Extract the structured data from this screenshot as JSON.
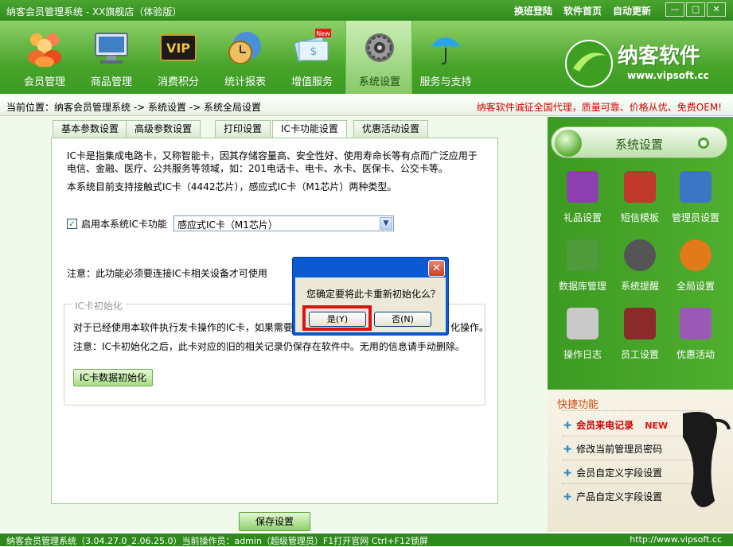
{
  "window": {
    "title": "纳客会员管理系统 - XX旗舰店（体验版）",
    "links": [
      "换班登陆",
      "软件首页",
      "自动更新"
    ],
    "controls": {
      "minimize": "—",
      "maximize": "□",
      "close": "✕"
    }
  },
  "toolbar": {
    "items": [
      {
        "label": "会员管理",
        "icon": "members-icon"
      },
      {
        "label": "商品管理",
        "icon": "monitor-icon"
      },
      {
        "label": "消费积分",
        "icon": "vip-icon"
      },
      {
        "label": "统计报表",
        "icon": "clock-icon"
      },
      {
        "label": "增值服务",
        "icon": "money-icon",
        "badge": "New"
      },
      {
        "label": "系统设置",
        "icon": "gear-icon",
        "active": true
      },
      {
        "label": "服务与支持",
        "icon": "umbrella-icon"
      }
    ]
  },
  "brand": {
    "name": "纳客软件",
    "url": "www.vipsoft.cc"
  },
  "breadcrumb": {
    "text": "当前位置：纳客会员管理系统 -> 系统设置 -> 系统全局设置",
    "promo": "纳客软件诚征全国代理，质量可靠、价格从优、免费OEM!"
  },
  "tabs": [
    "基本参数设置",
    "高级参数设置",
    "打印设置",
    "IC卡功能设置",
    "优惠活动设置"
  ],
  "panel": {
    "intro_line1": "IC卡是指集成电路卡，又称智能卡，因其存储容量高、安全性好、使用寿命长等有点而广泛应用于",
    "intro_line2": "电信、金融、医疗、公共服务等领域，如：201电话卡、电卡、水卡、医保卡、公交卡等。",
    "support_line": "本系统目前支持接触式IC卡（4442芯片），感应式IC卡（M1芯片）两种类型。",
    "enable_label": "启用本系统IC卡功能",
    "enable_checked": true,
    "card_type": "感应式IC卡（M1芯片）",
    "note": "注意：此功能必须要连接IC卡相关设备才可使用",
    "group_title": "IC卡初始化",
    "group_line1a": "对于已经使用本软件执行发卡操作的IC卡，如果需要",
    "group_line1b": "化操作。",
    "group_line2": "注意：IC卡初始化之后，此卡对应的旧的相关记录仍保存在软件中。无用的信息请手动删除。",
    "init_button": "IC卡数据初始化",
    "save_button": "保存设置"
  },
  "dialog": {
    "close": "✕",
    "message": "您确定要将此卡重新初始化么？",
    "yes": "是(Y)",
    "no": "否(N)"
  },
  "sidebar": {
    "title": "系统设置",
    "icons": [
      {
        "label": "礼品设置",
        "icon": "gift-icon",
        "color": "#8e3fb0"
      },
      {
        "label": "短信模板",
        "icon": "sms-icon",
        "color": "#c0392b"
      },
      {
        "label": "管理员设置",
        "icon": "admin-icon",
        "color": "#3a76c4"
      },
      {
        "label": "数据库管理",
        "icon": "database-icon",
        "color": "#4f9a3a"
      },
      {
        "label": "系统提醒",
        "icon": "alarm-icon",
        "color": "#555555"
      },
      {
        "label": "全局设置",
        "icon": "globe-icon",
        "color": "#e07a1a"
      },
      {
        "label": "操作日志",
        "icon": "log-icon",
        "color": "#c9c9c9"
      },
      {
        "label": "员工设置",
        "icon": "staff-icon",
        "color": "#8a2a2a"
      },
      {
        "label": "优惠活动",
        "icon": "promo-icon",
        "color": "#9b59b6"
      }
    ],
    "quick_title": "快捷功能",
    "quick_items": [
      {
        "label": "会员来电记录",
        "badge": "NEW"
      },
      {
        "label": "修改当前管理员密码"
      },
      {
        "label": "会员自定义字段设置"
      },
      {
        "label": "产品自定义字段设置"
      }
    ]
  },
  "status": {
    "text": "纳客会员管理系统（3.04.27.0_2.06.25.0）当前操作员：admin（超级管理员）F1打开官网 Ctrl+F12锁屏",
    "url": "http://www.vipsoft.cc"
  }
}
